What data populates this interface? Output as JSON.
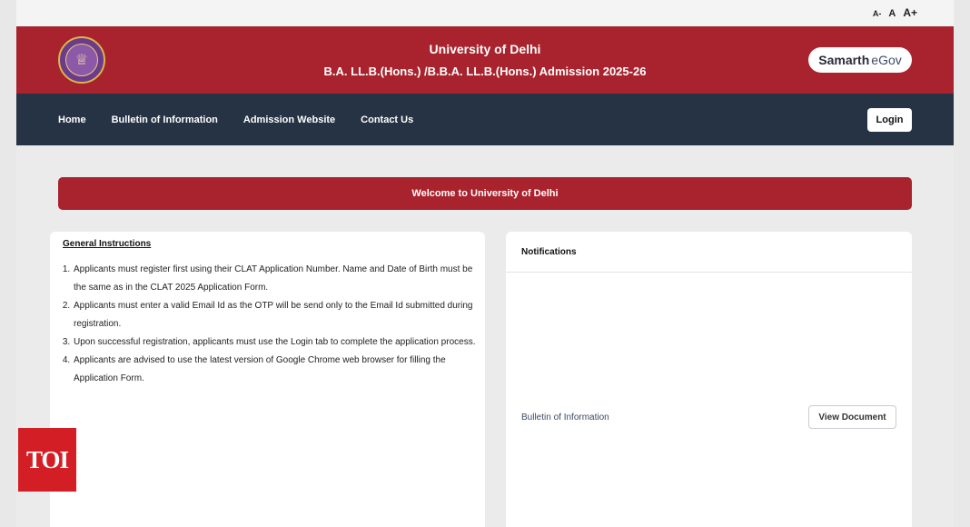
{
  "font_controls": {
    "decrease": "A-",
    "normal": "A",
    "increase": "A+"
  },
  "header": {
    "title": "University of Delhi",
    "subtitle": "B.A. LL.B.(Hons.) /B.B.A. LL.B.(Hons.) Admission 2025-26",
    "logo_icon": "university-seal-icon",
    "brand_part1": "Samarth",
    "brand_part2": "eGov",
    "accent_color": "#a8232d"
  },
  "nav": {
    "items": [
      "Home",
      "Bulletin of Information",
      "Admission Website",
      "Contact Us"
    ],
    "login_label": "Login",
    "background_color": "#263344"
  },
  "welcome": {
    "text": "Welcome to University of Delhi"
  },
  "instructions": {
    "title": "General Instructions",
    "items": [
      "Applicants must register first using their CLAT Application Number. Name and Date of Birth must be the same as in the CLAT 2025 Application Form.",
      "Applicants must enter a valid Email Id as the OTP will be send only to the Email Id submitted during registration.",
      "Upon successful registration, applicants must use the Login tab to complete the application process.",
      "Applicants are advised to use the latest version of Google Chrome web browser for filling the Application Form."
    ]
  },
  "notifications": {
    "title": "Notifications",
    "rows": [
      {
        "label": "Bulletin of Information",
        "button": "View Document"
      }
    ]
  },
  "watermark": {
    "text": "TOI"
  }
}
